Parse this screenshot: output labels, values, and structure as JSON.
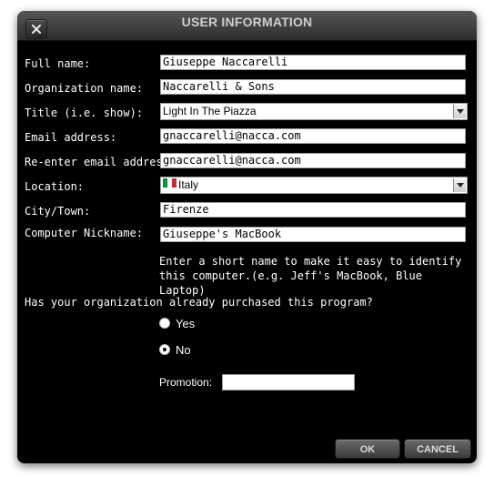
{
  "dialog": {
    "title": "USER INFORMATION",
    "close_icon": "close-icon"
  },
  "form": {
    "full_name": {
      "label": "Full name:",
      "value": "Giuseppe Naccarelli"
    },
    "organization": {
      "label": "Organization name:",
      "value": "Naccarelli & Sons"
    },
    "title": {
      "label": "Title (i.e. show):",
      "value": "Light In The Piazza"
    },
    "email": {
      "label": "Email address:",
      "value": "gnaccarelli@nacca.com"
    },
    "email_confirm": {
      "label": "Re-enter email address:",
      "value": "gnaccarelli@nacca.com"
    },
    "location": {
      "label": "Location:",
      "value": "Italy",
      "flag_colors": [
        "#009246",
        "#ffffff",
        "#ce2b37"
      ]
    },
    "city": {
      "label": "City/Town:",
      "value": "Firenze"
    },
    "nickname": {
      "label": "Computer Nickname:",
      "value": "Giuseppe's MacBook"
    },
    "nickname_hint": "Enter a short name to make it easy to identify this computer.(e.g. Jeff's MacBook, Blue Laptop)"
  },
  "purchase": {
    "question": "Has your organization already purchased this program?",
    "options": [
      {
        "label": "Yes",
        "selected": false
      },
      {
        "label": "No",
        "selected": true
      }
    ],
    "promotion_label": "Promotion:",
    "promotion_value": ""
  },
  "buttons": {
    "ok": "OK",
    "cancel": "CANCEL"
  }
}
